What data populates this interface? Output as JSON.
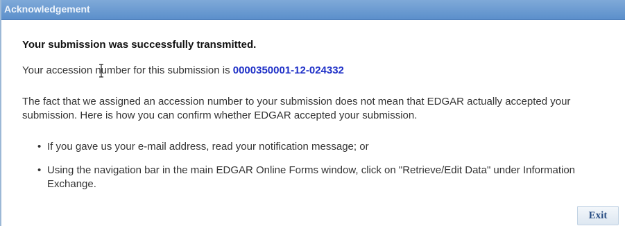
{
  "dialog": {
    "title": "Acknowledgement",
    "headline": "Your submission was successfully transmitted.",
    "accession_prefix": "Your accession number for this submission is ",
    "accession_number": "0000350001-12-024332",
    "paragraph": "The fact that we assigned an accession number to your submission does not mean that EDGAR actually accepted your submission. Here is how you can confirm whether EDGAR accepted your submission.",
    "bullets": [
      "If you gave us your e-mail address, read your notification message; or",
      "Using the navigation bar in the main EDGAR Online Forms window, click on \"Retrieve/Edit Data\" under Information Exchange."
    ],
    "exit_label": "Exit"
  },
  "colors": {
    "titlebar": "#5b8fcb",
    "accession_number": "#1d2fc7",
    "exit_text": "#2a4f84"
  }
}
